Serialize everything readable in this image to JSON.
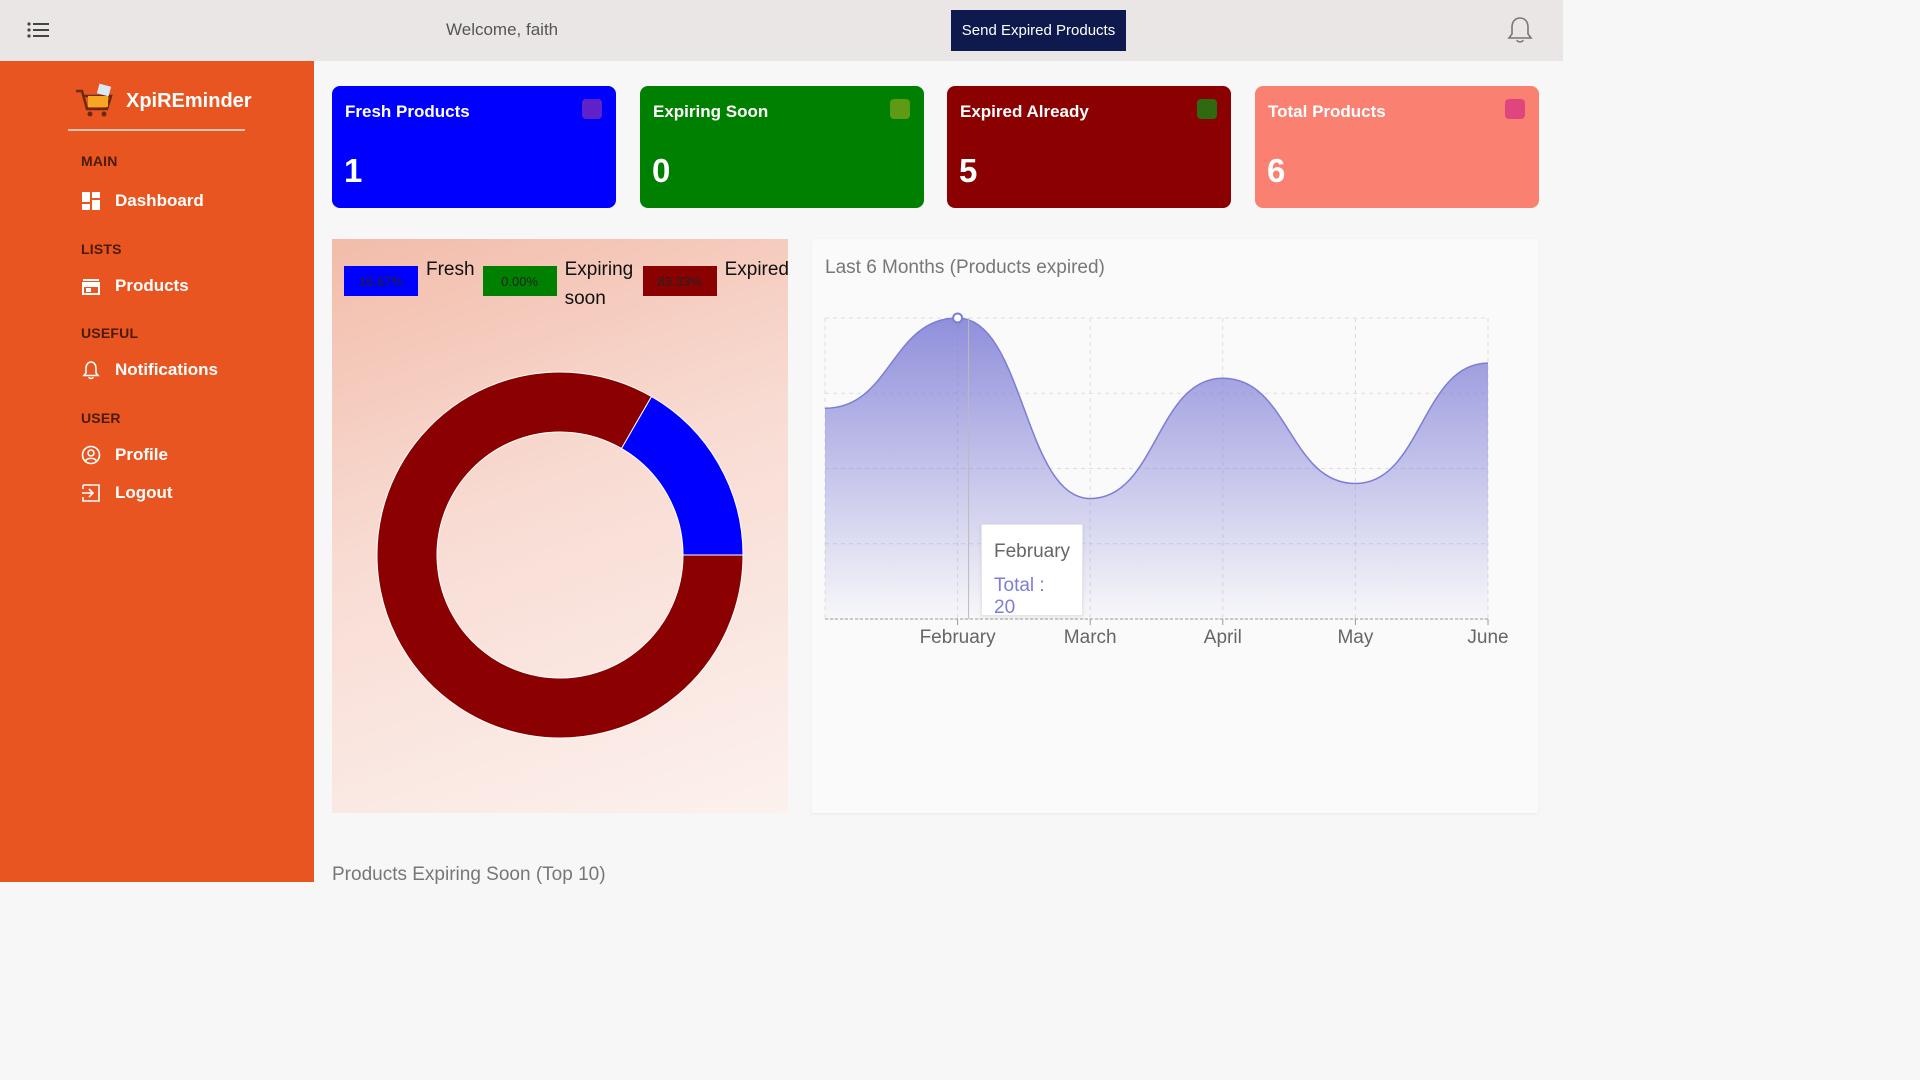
{
  "header": {
    "welcome": "Welcome, faith",
    "send_button": "Send Expired Products"
  },
  "sidebar": {
    "brand": "XpiREminder",
    "sections": [
      {
        "title": "MAIN",
        "items": [
          {
            "label": "Dashboard",
            "icon": "dashboard-icon"
          }
        ]
      },
      {
        "title": "LISTS",
        "items": [
          {
            "label": "Products",
            "icon": "store-icon"
          }
        ]
      },
      {
        "title": "USEFUL",
        "items": [
          {
            "label": "Notifications",
            "icon": "bell-icon"
          }
        ]
      },
      {
        "title": "USER",
        "items": [
          {
            "label": "Profile",
            "icon": "user-circle-icon"
          },
          {
            "label": "Logout",
            "icon": "logout-icon"
          }
        ]
      }
    ]
  },
  "cards": [
    {
      "title": "Fresh Products",
      "value": "1",
      "color": "#0000ff",
      "icon_color": "#5f22c9"
    },
    {
      "title": "Expiring Soon",
      "value": "0",
      "color": "#008000",
      "icon_color": "#5f9a14"
    },
    {
      "title": "Expired Already",
      "value": "5",
      "color": "#8b0000",
      "icon_color": "#2f6a10"
    },
    {
      "title": "Total Products",
      "value": "6",
      "color": "#fa8072",
      "icon_color": "#e0457d"
    }
  ],
  "donut": {
    "legend": [
      {
        "pct": "16.67%",
        "label": "Fresh",
        "color": "#0000ff"
      },
      {
        "pct": "0.00%",
        "label": "Expiring soon",
        "color": "#008000"
      },
      {
        "pct": "83.33%",
        "label": "Expired",
        "color": "#8b0000"
      }
    ]
  },
  "chart_data": {
    "type": "area",
    "title": "Last 6 Months (Products expired)",
    "categories": [
      "February",
      "March",
      "April",
      "May",
      "June"
    ],
    "series": [
      {
        "values": [
          14,
          20,
          8,
          16,
          9,
          17
        ]
      }
    ],
    "ylim": [
      0,
      20
    ],
    "grid": true,
    "tooltip": {
      "month": "February",
      "text": "Total : 20"
    },
    "color": "#7d7cd6"
  },
  "bottom_heading": "Products Expiring Soon (Top 10)"
}
